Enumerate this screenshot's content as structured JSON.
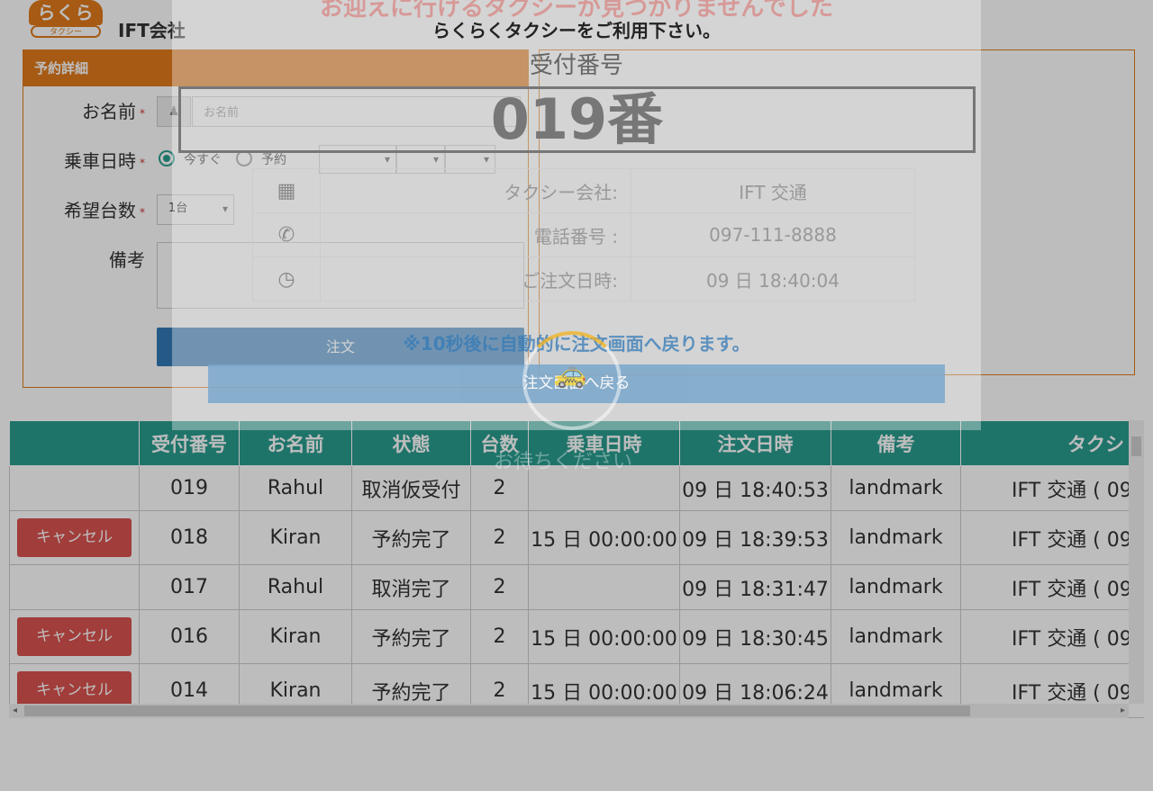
{
  "header": {
    "logo_top": "らくらく",
    "logo_bottom": "タクシー",
    "company": "IFT会社"
  },
  "form": {
    "title": "予約詳細",
    "name_label": "お名前",
    "name_placeholder": "お名前",
    "ride_label": "乗車日時",
    "radio_now": "今すぐ",
    "radio_reserve": "予約",
    "count_label": "希望台数",
    "count_value": "1台",
    "notes_label": "備考",
    "required_mark": "*",
    "order_button": "注文"
  },
  "table": {
    "headers": [
      "",
      "受付番号",
      "お名前",
      "状態",
      "台数",
      "乗車日時",
      "注文日時",
      "備考",
      "タクシ"
    ],
    "cancel_label": "キャンセル",
    "rows": [
      {
        "cancel": false,
        "no": "019",
        "name": "Rahul",
        "status": "取消仮受付",
        "count": "2",
        "ride": "",
        "ordered": "09 日 18:40:53",
        "note": "landmark",
        "taxi": "IFT 交通 ( 09"
      },
      {
        "cancel": true,
        "no": "018",
        "name": "Kiran",
        "status": "予約完了",
        "count": "2",
        "ride": "15 日 00:00:00",
        "ordered": "09 日 18:39:53",
        "note": "landmark",
        "taxi": "IFT 交通 ( 09"
      },
      {
        "cancel": false,
        "no": "017",
        "name": "Rahul",
        "status": "取消完了",
        "count": "2",
        "ride": "",
        "ordered": "09 日 18:31:47",
        "note": "landmark",
        "taxi": "IFT 交通 ( 09"
      },
      {
        "cancel": true,
        "no": "016",
        "name": "Kiran",
        "status": "予約完了",
        "count": "2",
        "ride": "15 日 00:00:00",
        "ordered": "09 日 18:30:45",
        "note": "landmark",
        "taxi": "IFT 交通 ( 09"
      },
      {
        "cancel": true,
        "no": "014",
        "name": "Kiran",
        "status": "予約完了",
        "count": "2",
        "ride": "15 日 00:00:00",
        "ordered": "09 日 18:06:24",
        "note": "landmark",
        "taxi": "IFT 交通 ( 09"
      }
    ]
  },
  "modal": {
    "headline": "お迎えに行けるタクシーが見つかりませんでした",
    "subline": "らくらくタクシーをご利用下さい。",
    "number_label": "受付番号",
    "number_value": "019番",
    "info": [
      {
        "icon": "building-icon",
        "glyph": "▦",
        "label": "タクシー会社:",
        "value": "IFT 交通"
      },
      {
        "icon": "phone-icon",
        "glyph": "✆",
        "label": "電話番号 :",
        "value": "097-111-8888"
      },
      {
        "icon": "clock-icon",
        "glyph": "◷",
        "label": "ご注文日時:",
        "value": "09 日 18:40:04"
      }
    ],
    "auto_return_note": "※10秒後に自動的に注文画面へ戻ります。",
    "back_button": "注文画面へ戻る",
    "wait_text": "お待ちください"
  }
}
